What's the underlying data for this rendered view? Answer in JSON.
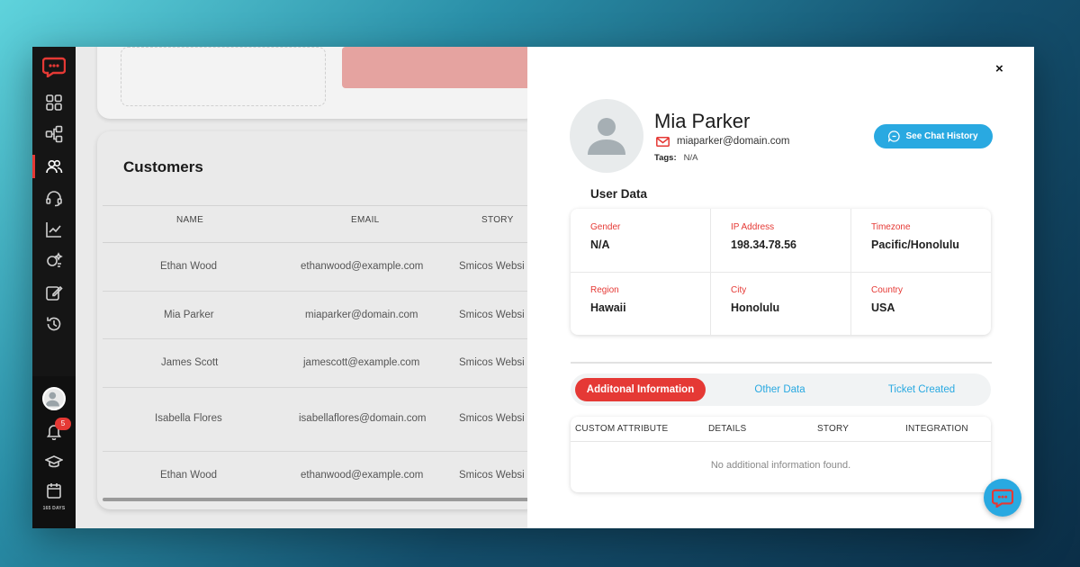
{
  "sidebar": {
    "items": [
      {
        "name": "dashboard-grid-icon"
      },
      {
        "name": "flow-icon"
      },
      {
        "name": "users-icon",
        "active": true
      },
      {
        "name": "headset-icon"
      },
      {
        "name": "chart-icon"
      },
      {
        "name": "sparkle-icon"
      },
      {
        "name": "edit-icon"
      },
      {
        "name": "history-icon"
      }
    ],
    "notification_count": "5",
    "days_label": "165 DAYS"
  },
  "customers": {
    "title": "Customers",
    "columns": [
      "NAME",
      "EMAIL",
      "STORY"
    ],
    "rows": [
      {
        "name": "Ethan Wood",
        "email": "ethanwood@example.com",
        "story": "Smicos Websi"
      },
      {
        "name": "Mia Parker",
        "email": "miaparker@domain.com",
        "story": "Smicos Websi"
      },
      {
        "name": "James Scott",
        "email": "jamescott@example.com",
        "story": "Smicos Websi"
      },
      {
        "name": "Isabella Flores",
        "email": "isabellaflores@domain.com",
        "story": "Smicos Websi"
      },
      {
        "name": "Ethan Wood",
        "email": "ethanwood@example.com",
        "story": "Smicos Websi"
      }
    ]
  },
  "profile": {
    "close": "×",
    "name": "Mia Parker",
    "email": "miaparker@domain.com",
    "tags_label": "Tags:",
    "tags_value": "N/A",
    "chat_history_label": "See Chat History"
  },
  "user_data": {
    "title": "User Data",
    "fields": [
      {
        "label": "Gender",
        "value": "N/A"
      },
      {
        "label": "IP Address",
        "value": "198.34.78.56"
      },
      {
        "label": "Timezone",
        "value": "Pacific/Honolulu"
      },
      {
        "label": "Region",
        "value": "Hawaii"
      },
      {
        "label": "City",
        "value": "Honolulu"
      },
      {
        "label": "Country",
        "value": "USA"
      }
    ]
  },
  "tabs": [
    {
      "label": "Additonal Information",
      "active": true
    },
    {
      "label": "Other Data",
      "active": false
    },
    {
      "label": "Ticket Created",
      "active": false
    }
  ],
  "info_table": {
    "columns": [
      "CUSTOM ATTRIBUTE",
      "DETAILS",
      "STORY",
      "INTEGRATION"
    ],
    "empty_message": "No additional information found."
  },
  "colors": {
    "accent_red": "#e53935",
    "accent_blue": "#29a9e1",
    "sidebar_bg": "#151515"
  }
}
